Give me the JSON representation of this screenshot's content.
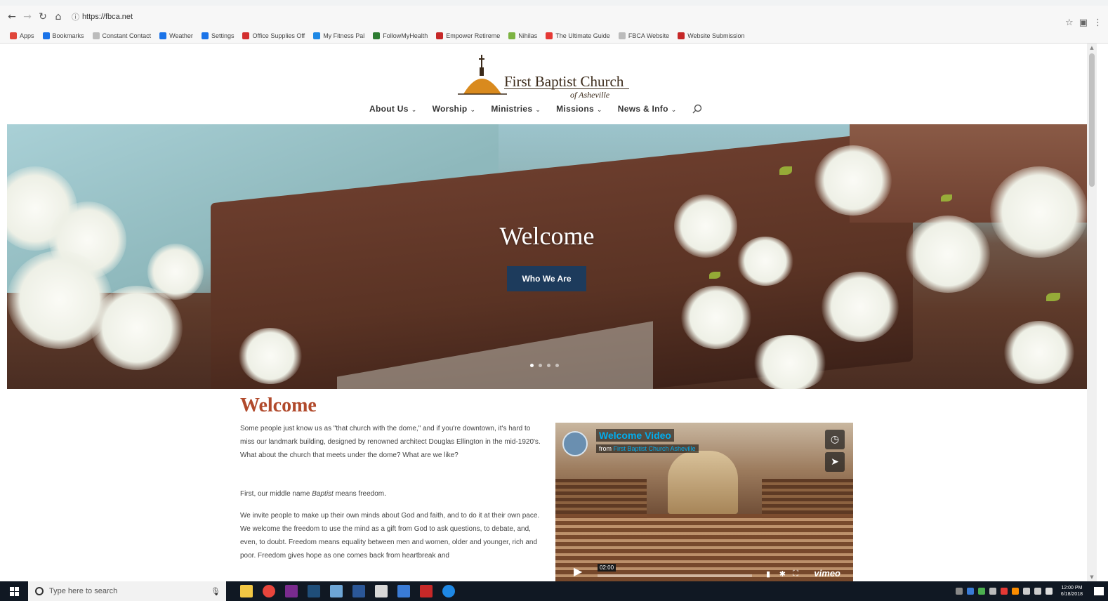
{
  "browser": {
    "url": "https://fbca.net",
    "bookmarks": [
      {
        "label": "Apps",
        "color": "#e0463a"
      },
      {
        "label": "Bookmarks",
        "color": "#1a73e8"
      },
      {
        "label": "Constant Contact",
        "color": "#bbbbbb"
      },
      {
        "label": "Weather",
        "color": "#1a73e8"
      },
      {
        "label": "Settings",
        "color": "#1a73e8"
      },
      {
        "label": "Office Supplies Off",
        "color": "#d32f2f"
      },
      {
        "label": "My Fitness Pal",
        "color": "#1e88e5"
      },
      {
        "label": "FollowMyHealth",
        "color": "#2e7d32"
      },
      {
        "label": "Empower Retireme",
        "color": "#c62828"
      },
      {
        "label": "Nihilas",
        "color": "#7cb342"
      },
      {
        "label": "The Ultimate Guide",
        "color": "#e53935"
      },
      {
        "label": "FBCA Website",
        "color": "#bbbbbb"
      },
      {
        "label": "Website Submission",
        "color": "#c62828"
      }
    ]
  },
  "site": {
    "logo_name": "First Baptist Church",
    "logo_sub": "of Asheville",
    "nav": [
      "About Us",
      "Worship",
      "Ministries",
      "Missions",
      "News & Info"
    ]
  },
  "hero": {
    "title": "Welcome",
    "button": "Who We Are",
    "slides": 4,
    "active_slide": 1
  },
  "content": {
    "title": "Welcome",
    "p1": "Some people just know us as \"that church with the dome,\" and if you're downtown, it's hard to miss our landmark building, designed by renowned architect Douglas Ellington in the mid-1920's. What about the church that meets under the dome? What are we like?",
    "p2": "First, our middle name Baptist means freedom.",
    "p3": "We invite people to make up their own minds about God and faith, and to do it at their own pace. We welcome the freedom to use the mind as a gift from God to ask questions, to debate, and, even, to doubt. Freedom means equality between men and women, older and younger, rich and poor. Freedom gives hope as one comes back from heartbreak and"
  },
  "video": {
    "title": "Welcome Video",
    "from_prefix": "from",
    "from_source": "First Baptist Church Asheville",
    "time": "02:00",
    "provider": "vimeo"
  },
  "taskbar": {
    "search_placeholder": "Type here to search",
    "time": "12:00 PM",
    "date": "6/18/2018"
  }
}
